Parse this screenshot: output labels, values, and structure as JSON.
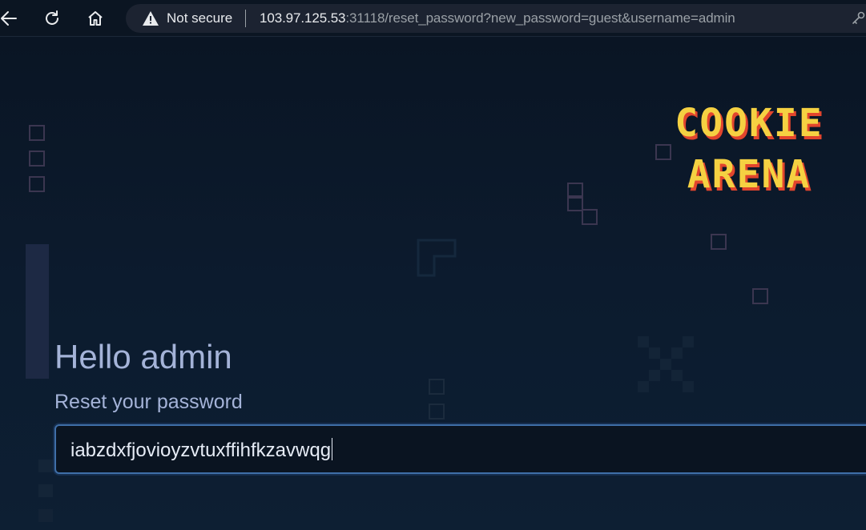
{
  "browser": {
    "not_secure_label": "Not secure",
    "url_host": "103.97.125.53",
    "url_rest": ":31118/reset_password?new_password=guest&username=admin"
  },
  "logo": {
    "line1": "COOKIE",
    "line2": "ARENA",
    "fill_color": "#f5d142",
    "shadow_color": "#e2452d"
  },
  "main": {
    "greeting": "Hello admin",
    "subtitle": "Reset your password",
    "password_value": "iabzdxfjovioyzvtuxffihfkzavwqg"
  },
  "icons": {
    "back": "arrow-left-icon",
    "reload": "reload-icon",
    "home": "home-icon",
    "warning": "warning-triangle-icon",
    "key": "key-icon"
  }
}
